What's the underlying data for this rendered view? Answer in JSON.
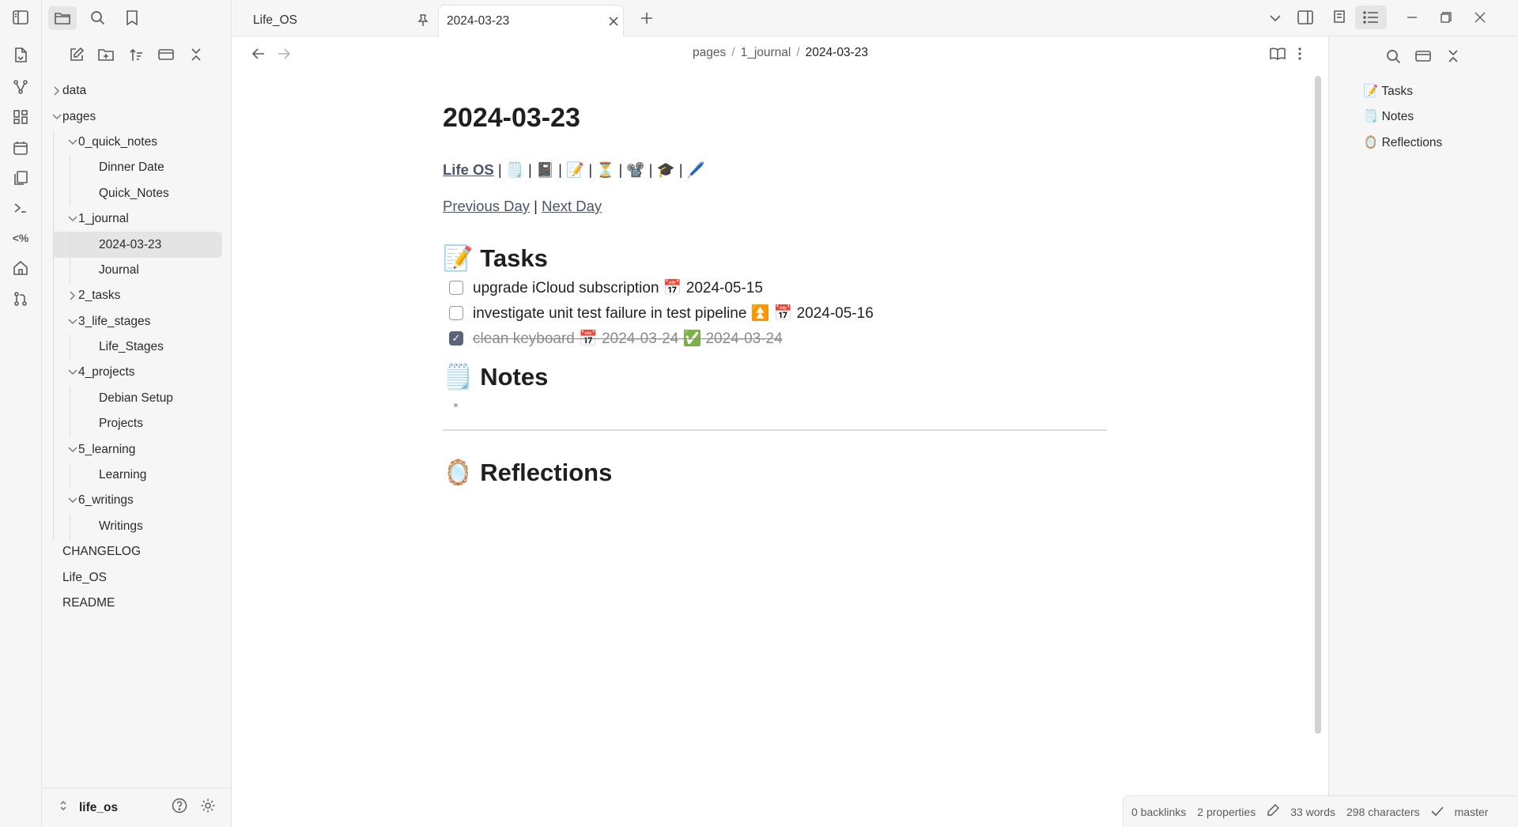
{
  "ribbon": {
    "icons": [
      "open-quick-switcher-icon",
      "graph-view-icon",
      "canvas-icon",
      "daily-note-calendar-icon",
      "templates-icon",
      "command-palette-icon",
      "templater-icon",
      "home-icon",
      "git-icon"
    ]
  },
  "sidebar": {
    "tree": [
      {
        "label": "data",
        "depth": 0,
        "type": "folder",
        "expanded": false
      },
      {
        "label": "pages",
        "depth": 0,
        "type": "folder",
        "expanded": true
      },
      {
        "label": "0_quick_notes",
        "depth": 1,
        "type": "folder",
        "expanded": true
      },
      {
        "label": "Dinner Date",
        "depth": 2,
        "type": "file"
      },
      {
        "label": "Quick_Notes",
        "depth": 2,
        "type": "file"
      },
      {
        "label": "1_journal",
        "depth": 1,
        "type": "folder",
        "expanded": true
      },
      {
        "label": "2024-03-23",
        "depth": 2,
        "type": "file",
        "selected": true
      },
      {
        "label": "Journal",
        "depth": 2,
        "type": "file"
      },
      {
        "label": "2_tasks",
        "depth": 1,
        "type": "folder",
        "expanded": false
      },
      {
        "label": "3_life_stages",
        "depth": 1,
        "type": "folder",
        "expanded": true
      },
      {
        "label": "Life_Stages",
        "depth": 2,
        "type": "file"
      },
      {
        "label": "4_projects",
        "depth": 1,
        "type": "folder",
        "expanded": true
      },
      {
        "label": "Debian Setup",
        "depth": 2,
        "type": "file"
      },
      {
        "label": "Projects",
        "depth": 2,
        "type": "file"
      },
      {
        "label": "5_learning",
        "depth": 1,
        "type": "folder",
        "expanded": true
      },
      {
        "label": "Learning",
        "depth": 2,
        "type": "file"
      },
      {
        "label": "6_writings",
        "depth": 1,
        "type": "folder",
        "expanded": true
      },
      {
        "label": "Writings",
        "depth": 2,
        "type": "file"
      },
      {
        "label": "CHANGELOG",
        "depth": 0,
        "type": "file"
      },
      {
        "label": "Life_OS",
        "depth": 0,
        "type": "file"
      },
      {
        "label": "README",
        "depth": 0,
        "type": "file"
      }
    ],
    "vault_name": "life_os"
  },
  "tabs": [
    {
      "label": "Life_OS",
      "pinned": true,
      "active": false
    },
    {
      "label": "2024-03-23",
      "pinned": false,
      "active": true
    }
  ],
  "breadcrumb": {
    "part1": "pages",
    "part2": "1_journal",
    "current": "2024-03-23"
  },
  "note": {
    "title": "2024-03-23",
    "nav_link": "Life OS",
    "nav_emojis": [
      "🗒️",
      "📓",
      "📝",
      "⏳",
      "📽️",
      "🎓",
      "🖊️"
    ],
    "prev_label": "Previous Day",
    "next_label": "Next Day",
    "tasks_heading": "📝 Tasks",
    "tasks": [
      {
        "text": "upgrade iCloud subscription 📅 2024-05-15",
        "done": false
      },
      {
        "text": "investigate unit test failure in test pipeline ⏫ 📅 2024-05-16",
        "done": false
      },
      {
        "text": "clean keyboard 📅 2024-03-24 ✅ 2024-03-24",
        "done": true
      }
    ],
    "notes_heading": "🗒️ Notes",
    "reflections_heading": "🪞 Reflections"
  },
  "outline": {
    "items": [
      "📝 Tasks",
      "🗒️ Notes",
      "🪞 Reflections"
    ]
  },
  "status": {
    "backlinks": "0 backlinks",
    "properties": "2 properties",
    "words": "33 words",
    "characters": "298 characters",
    "branch": "master"
  }
}
